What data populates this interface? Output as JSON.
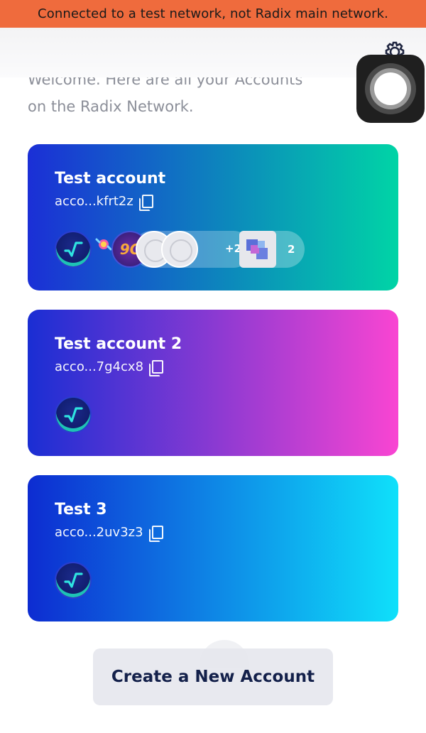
{
  "banner": {
    "text": "Connected to a test network, not Radix main network."
  },
  "header": {
    "welcome_line1": "Welcome. Here are all your Accounts",
    "welcome_line2": "on the Radix Network.",
    "settings_icon": "gear-icon"
  },
  "accounts": [
    {
      "name": "Test account",
      "address": "acco...kfrt2z",
      "gradient": [
        "#1b2fd6",
        "#00d4a6"
      ],
      "tokens_more": "+2",
      "nft_count": "2",
      "token_glyph": "9C"
    },
    {
      "name": "Test account 2",
      "address": "acco...7g4cx8",
      "gradient": [
        "#1a2ed3",
        "#f945d2"
      ]
    },
    {
      "name": "Test 3",
      "address": "acco...2uv3z3",
      "gradient": [
        "#0d2cd1",
        "#0fe0fa"
      ]
    }
  ],
  "actions": {
    "create_label": "Create a New Account"
  }
}
